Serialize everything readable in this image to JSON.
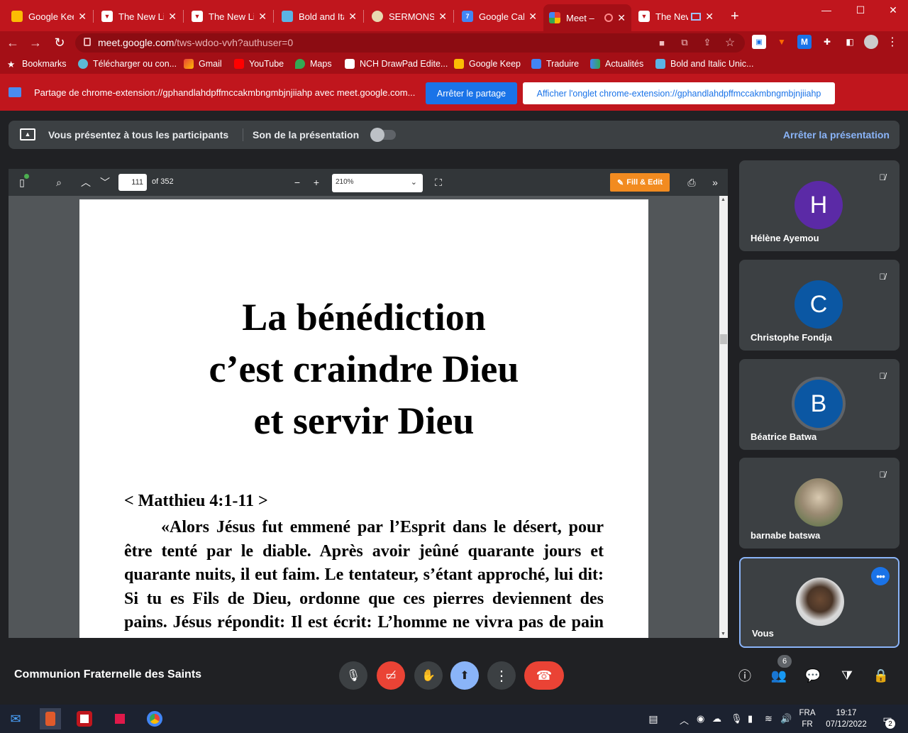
{
  "browser": {
    "tabs": [
      {
        "label": "Google Keep",
        "color": "#fbbc04"
      },
      {
        "label": "The New Life",
        "color": "#c0161d"
      },
      {
        "label": "The New Life",
        "color": "#c0161d"
      },
      {
        "label": "Bold and Italic",
        "color": "#5bb4e5"
      },
      {
        "label": "SERMONS S",
        "color": "#e8d9b0"
      },
      {
        "label": "Google Calendar",
        "color": "#4285f4"
      },
      {
        "label": "Meet –",
        "color": "#34a853"
      },
      {
        "label": "The New",
        "color": "#c0161d"
      }
    ],
    "new_tab": "+",
    "url_host": "meet.google.com",
    "url_path": "/tws-wdoo-vvh?authuser=0",
    "bookmarks": [
      "Bookmarks",
      "Télécharger ou con...",
      "Gmail",
      "YouTube",
      "Maps",
      "NCH DrawPad Edite...",
      "Google Keep",
      "Traduire",
      "Actualités",
      "Bold and Italic Unic..."
    ]
  },
  "sharebar": {
    "text": "Partage de chrome-extension://gphandlahdpffmccakmbngmbjnjiiahp avec meet.google.com...",
    "stop_label": "Arrêter le partage",
    "show_label": "Afficher l'onglet chrome-extension://gphandlahdpffmccakmbngmbjnjiiahp"
  },
  "presenting": {
    "text": "Vous présentez à tous les participants",
    "sound": "Son de la présentation",
    "stop": "Arrêter la présentation"
  },
  "pdf": {
    "page": "111",
    "of": "of 352",
    "zoom": "210%",
    "fill_edit": "Fill & Edit",
    "title": "La bénédiction c’est craindre Dieu et servir Dieu",
    "ref": "< Matthieu 4:1-11 >",
    "body": "«Alors Jésus fut emmené par l’Esprit dans le désert, pour être tenté par le diable. Après avoir jeûné quarante jours et quarante nuits, il eut faim. Le tentateur, s’étant approché, lui dit: Si tu es Fils de Dieu, ordonne que ces pierres deviennent des pains. Jésus répondit: Il est écrit: L’homme ne vivra pas de pain seulement, mais de toute parole"
  },
  "participants": [
    {
      "name": "Hélène Ayemou",
      "initial": "H",
      "color": "#5b2aa6"
    },
    {
      "name": "Christophe Fondja",
      "initial": "C",
      "color": "#0b57a3"
    },
    {
      "name": "Béatrice Batwa",
      "initial": "B",
      "color": "#0b57a3"
    },
    {
      "name": "barnabe batswa",
      "initial": "",
      "color": ""
    },
    {
      "name": "Vous",
      "initial": "",
      "color": ""
    }
  ],
  "meeting": {
    "name": "Communion Fraternelle des Saints",
    "participant_count": "6"
  },
  "system": {
    "lang1": "FRA",
    "lang2": "FR",
    "time": "19:17",
    "date": "07/12/2022",
    "notif": "2"
  }
}
